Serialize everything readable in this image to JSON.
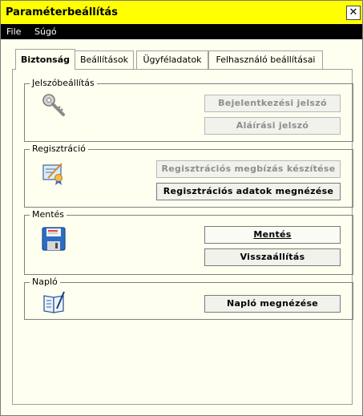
{
  "window": {
    "title": "Paraméterbeállítás",
    "close_glyph": "✕"
  },
  "menu": {
    "file": "File",
    "help": "Súgó"
  },
  "tabs": [
    {
      "label": "Biztonság",
      "active": true
    },
    {
      "label": "Beállítások",
      "active": false
    },
    {
      "label": "Ügyféladatok",
      "active": false
    },
    {
      "label": "Felhasználó beállításai",
      "active": false
    }
  ],
  "sections": {
    "password": {
      "title": "Jelszóbeállítás",
      "icon": "key-icon",
      "buttons": {
        "login": "Bejelentkezési jelszó",
        "signature": "Aláírási jelszó"
      }
    },
    "registration": {
      "title": "Regisztráció",
      "icon": "certificate-icon",
      "buttons": {
        "create": "Regisztrációs megbízás készítése",
        "view": "Regisztrációs adatok megnézése"
      }
    },
    "save": {
      "title": "Mentés",
      "icon": "floppy-disk-icon",
      "buttons": {
        "save": "Mentés",
        "restore": "Visszaállítás"
      }
    },
    "log": {
      "title": "Napló",
      "icon": "logbook-icon",
      "buttons": {
        "view": "Napló megnézése"
      }
    }
  },
  "colors": {
    "titlebar": "#ffff00",
    "menubar": "#000000",
    "background": "#fffff0"
  }
}
